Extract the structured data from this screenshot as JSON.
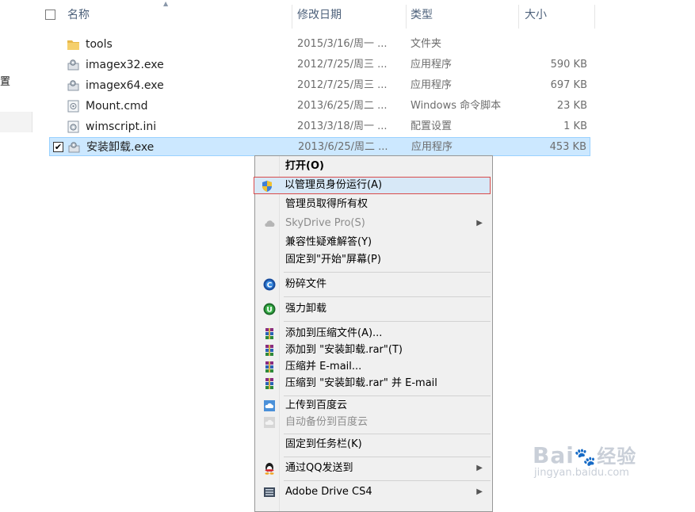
{
  "nav": {
    "fragment_text": "置"
  },
  "header": {
    "name": "名称",
    "date": "修改日期",
    "type": "类型",
    "size": "大小"
  },
  "files": [
    {
      "name": "tools",
      "date": "2015/3/16/周一 ...",
      "type": "文件夹",
      "size": "",
      "icon": "folder-icon"
    },
    {
      "name": "imagex32.exe",
      "date": "2012/7/25/周三 ...",
      "type": "应用程序",
      "size": "590 KB",
      "icon": "exe-icon"
    },
    {
      "name": "imagex64.exe",
      "date": "2012/7/25/周三 ...",
      "type": "应用程序",
      "size": "697 KB",
      "icon": "exe-icon"
    },
    {
      "name": "Mount.cmd",
      "date": "2013/6/25/周二 ...",
      "type": "Windows 命令脚本",
      "size": "23 KB",
      "icon": "cmd-icon"
    },
    {
      "name": "wimscript.ini",
      "date": "2013/3/18/周一 ...",
      "type": "配置设置",
      "size": "1 KB",
      "icon": "ini-icon"
    },
    {
      "name": "安装卸载.exe",
      "date": "2013/6/25/周二 ...",
      "type": "应用程序",
      "size": "453 KB",
      "icon": "exe-icon",
      "selected": true
    }
  ],
  "context_menu": {
    "open": "打开(O)",
    "run_as_admin": "以管理员身份运行(A)",
    "take_ownership": "管理员取得所有权",
    "skydrive": "SkyDrive Pro(S)",
    "compat": "兼容性疑难解答(Y)",
    "pin_start": "固定到\"开始\"屏幕(P)",
    "shred": "粉碎文件",
    "force_uninstall": "强力卸载",
    "add_archive": "添加到压缩文件(A)...",
    "add_rar": "添加到 \"安装卸载.rar\"(T)",
    "compress_email": "压缩并 E-mail...",
    "compress_rar_email": "压缩到 \"安装卸载.rar\" 并 E-mail",
    "upload_baidu": "上传到百度云",
    "auto_backup_baidu": "自动备份到百度云",
    "pin_taskbar": "固定到任务栏(K)",
    "send_qq": "通过QQ发送到",
    "adobe_drive": "Adobe Drive CS4"
  },
  "watermark": {
    "logo": "Bai",
    "logo_cn": "经验",
    "url": "jingyan.baidu.com"
  }
}
